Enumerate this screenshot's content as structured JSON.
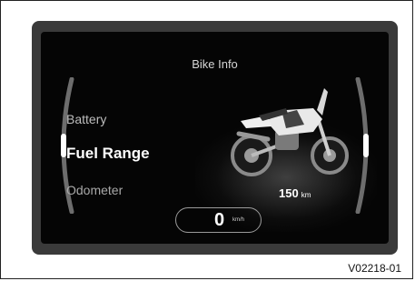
{
  "screen": {
    "title": "Bike Info",
    "menu": {
      "items": [
        {
          "label": "Battery"
        },
        {
          "label": "Fuel Range"
        },
        {
          "label": "Odometer"
        }
      ]
    },
    "range": {
      "value": "150",
      "unit": "km"
    },
    "speed": {
      "value": "0",
      "unit": "km/h"
    }
  },
  "figure_code": "V02218-01",
  "icons": {
    "vehicle": "motorcycle-icon"
  }
}
